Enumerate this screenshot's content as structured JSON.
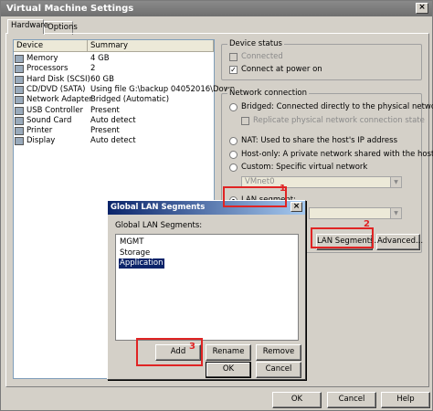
{
  "window": {
    "title": "Virtual Machine Settings",
    "tabs": [
      "Hardware",
      "Options"
    ]
  },
  "devices": {
    "columns": [
      "Device",
      "Summary"
    ],
    "rows": [
      {
        "device": "Memory",
        "summary": "4 GB",
        "icon": "memory-icon"
      },
      {
        "device": "Processors",
        "summary": "2",
        "icon": "processor-icon"
      },
      {
        "device": "Hard Disk (SCSI)",
        "summary": "60 GB",
        "icon": "harddisk-icon"
      },
      {
        "device": "CD/DVD (SATA)",
        "summary": "Using file G:\\backup 04052016\\Down...",
        "icon": "cdrom-icon"
      },
      {
        "device": "Network Adapter",
        "summary": "Bridged (Automatic)",
        "icon": "network-adapter-icon"
      },
      {
        "device": "USB Controller",
        "summary": "Present",
        "icon": "usb-icon"
      },
      {
        "device": "Sound Card",
        "summary": "Auto detect",
        "icon": "sound-card-icon"
      },
      {
        "device": "Printer",
        "summary": "Present",
        "icon": "printer-icon"
      },
      {
        "device": "Display",
        "summary": "Auto detect",
        "icon": "display-icon"
      }
    ],
    "selected_index": 4
  },
  "device_status": {
    "title": "Device status",
    "connected": "Connected",
    "connect_at_power_on": "Connect at power on"
  },
  "network_connection": {
    "title": "Network connection",
    "bridged": "Bridged: Connected directly to the physical network",
    "replicate": "Replicate physical network connection state",
    "nat": "NAT: Used to share the host's IP address",
    "host_only": "Host-only: A private network shared with the host",
    "custom": "Custom: Specific virtual network",
    "vmnet_value": "VMnet0",
    "lan_segment": "LAN segment:",
    "lan_segments_button": "LAN Segments...",
    "advanced_button": "Advanced..."
  },
  "dialog": {
    "title": "Global LAN Segments",
    "label": "Global LAN Segments:",
    "items": [
      "MGMT",
      "Storage",
      "Application"
    ],
    "selected_index": 2,
    "add": "Add",
    "rename": "Rename",
    "remove": "Remove",
    "ok": "OK",
    "cancel": "Cancel"
  },
  "footer": {
    "ok": "OK",
    "cancel": "Cancel",
    "help": "Help"
  },
  "annotations": [
    "1",
    "2",
    "3"
  ],
  "colors": {
    "annotation_red": "#e02424",
    "selection_blue": "#0a246a"
  }
}
